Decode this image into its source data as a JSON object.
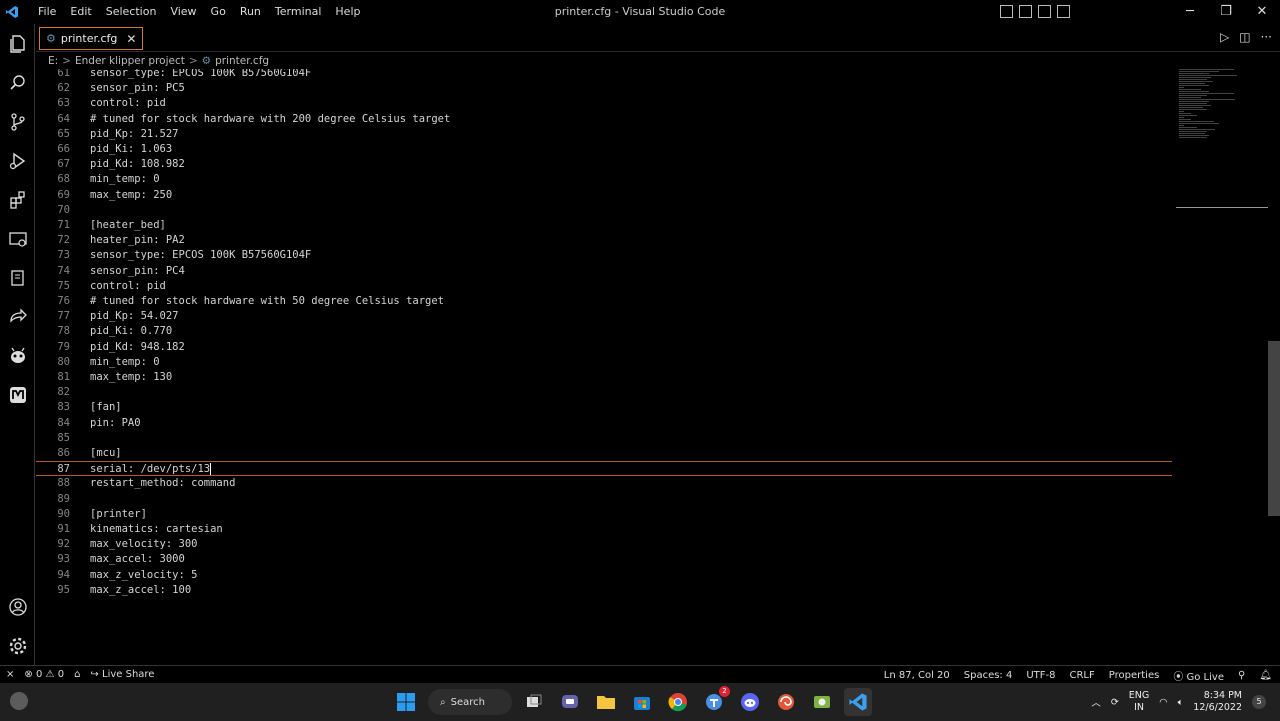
{
  "titlebar": {
    "menu": [
      "File",
      "Edit",
      "Selection",
      "View",
      "Go",
      "Run",
      "Terminal",
      "Help"
    ],
    "title": "printer.cfg - Visual Studio Code",
    "minimize": "─",
    "restore": "❐",
    "close": "✕"
  },
  "tab": {
    "label": "printer.cfg",
    "close": "✕"
  },
  "breadcrumb": {
    "drive": "E:",
    "folder": "Ender klipper project",
    "file": "printer.cfg",
    "separator": ">"
  },
  "editor": {
    "current_line": 87,
    "lines": [
      {
        "n": "61",
        "text": "sensor_type: EPCOS 100K B57560G104F",
        "kind": "code"
      },
      {
        "n": "62",
        "text": "sensor_pin: PC5",
        "kind": "code"
      },
      {
        "n": "63",
        "text": "control: pid",
        "kind": "code"
      },
      {
        "n": "64",
        "text": "# tuned for stock hardware with 200 degree Celsius target",
        "kind": "comment"
      },
      {
        "n": "65",
        "text": "pid_Kp: 21.527",
        "kind": "code"
      },
      {
        "n": "66",
        "text": "pid_Ki: 1.063",
        "kind": "code"
      },
      {
        "n": "67",
        "text": "pid_Kd: 108.982",
        "kind": "code"
      },
      {
        "n": "68",
        "text": "min_temp: 0",
        "kind": "code"
      },
      {
        "n": "69",
        "text": "max_temp: 250",
        "kind": "code"
      },
      {
        "n": "70",
        "text": "",
        "kind": "code"
      },
      {
        "n": "71",
        "text": "[heater_bed]",
        "kind": "section"
      },
      {
        "n": "72",
        "text": "heater_pin: PA2",
        "kind": "code"
      },
      {
        "n": "73",
        "text": "sensor_type: EPCOS 100K B57560G104F",
        "kind": "code"
      },
      {
        "n": "74",
        "text": "sensor_pin: PC4",
        "kind": "code"
      },
      {
        "n": "75",
        "text": "control: pid",
        "kind": "code"
      },
      {
        "n": "76",
        "text": "# tuned for stock hardware with 50 degree Celsius target",
        "kind": "comment"
      },
      {
        "n": "77",
        "text": "pid_Kp: 54.027",
        "kind": "code"
      },
      {
        "n": "78",
        "text": "pid_Ki: 0.770",
        "kind": "code"
      },
      {
        "n": "79",
        "text": "pid_Kd: 948.182",
        "kind": "code"
      },
      {
        "n": "80",
        "text": "min_temp: 0",
        "kind": "code"
      },
      {
        "n": "81",
        "text": "max_temp: 130",
        "kind": "code"
      },
      {
        "n": "82",
        "text": "",
        "kind": "code"
      },
      {
        "n": "83",
        "text": "[fan]",
        "kind": "section"
      },
      {
        "n": "84",
        "text": "pin: PA0",
        "kind": "code"
      },
      {
        "n": "85",
        "text": "",
        "kind": "code"
      },
      {
        "n": "86",
        "text": "[mcu]",
        "kind": "section"
      },
      {
        "n": "87",
        "text": "serial: /dev/pts/13",
        "kind": "code"
      },
      {
        "n": "88",
        "text": "restart_method: command",
        "kind": "code"
      },
      {
        "n": "89",
        "text": "",
        "kind": "code"
      },
      {
        "n": "90",
        "text": "[printer]",
        "kind": "section"
      },
      {
        "n": "91",
        "text": "kinematics: cartesian",
        "kind": "code"
      },
      {
        "n": "92",
        "text": "max_velocity: 300",
        "kind": "code"
      },
      {
        "n": "93",
        "text": "max_accel: 3000",
        "kind": "code"
      },
      {
        "n": "94",
        "text": "max_z_velocity: 5",
        "kind": "code"
      },
      {
        "n": "95",
        "text": "max_z_accel: 100",
        "kind": "code"
      }
    ]
  },
  "statusbar": {
    "errors": "0",
    "warnings": "0",
    "live_share": "Live Share",
    "position": "Ln 87, Col 20",
    "spaces": "Spaces: 4",
    "encoding": "UTF-8",
    "eol": "CRLF",
    "language": "Properties",
    "go_live": "Go Live"
  },
  "taskbar": {
    "search": "Search",
    "teams_badge": "2",
    "lang_top": "ENG",
    "lang_bottom": "IN",
    "time": "8:34 PM",
    "date": "12/6/2022",
    "notifications": "5"
  },
  "colors": {
    "accent": "#d27b2f",
    "section": "#d7ba7d",
    "comment": "#6a9955"
  }
}
